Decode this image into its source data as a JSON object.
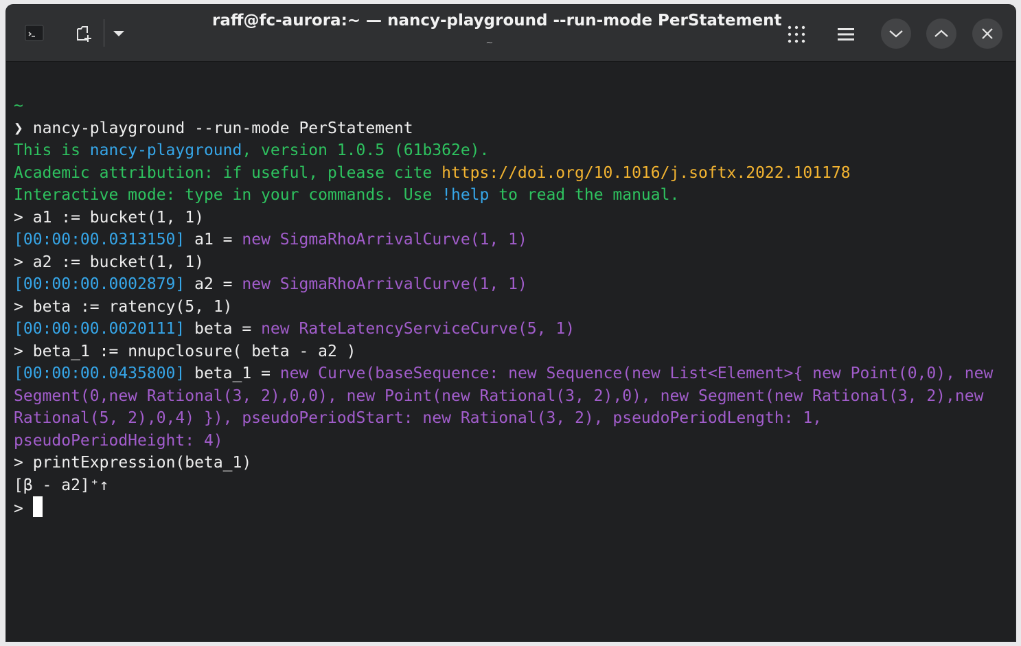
{
  "window": {
    "title": "raff@fc-aurora:~ — nancy-playground --run-mode PerStatement",
    "subtitle": "~"
  },
  "toolbar": {
    "terminal_icon": "terminal-icon",
    "new_tab_icon": "new-tab-icon",
    "dropdown_icon": "chevron-down-icon",
    "grid_icon": "grid-icon",
    "menu_icon": "hamburger-menu-icon",
    "minimize_icon": "chevron-down-icon",
    "maximize_icon": "chevron-up-icon",
    "close_icon": "close-icon"
  },
  "colors": {
    "green": "#2ec25f",
    "blue": "#36a6e8",
    "orange": "#f3b431",
    "purple": "#a25dcc",
    "text": "#eeeeee"
  },
  "terminal": {
    "cwd": "~",
    "prompt_symbol": "❯",
    "command": "nancy-playground --run-mode PerStatement",
    "banner": {
      "l1_a": "This is ",
      "l1_b": "nancy-playground",
      "l1_c": ", version 1.0.5 (61b362e).",
      "l2_a": "Academic attribution: if useful, please cite ",
      "l2_b": "https://doi.org/10.1016/j.softx.2022.101178",
      "l3_a": "Interactive mode: type in your commands. Use ",
      "l3_b": "!help",
      "l3_c": " to read the manual."
    },
    "input_prompt": ">",
    "entries": [
      {
        "input": "a1 := bucket(1, 1)",
        "time": "[00:00:00.0313150]",
        "name": "a1",
        "eq": "=",
        "value": "new SigmaRhoArrivalCurve(1, 1)"
      },
      {
        "input": "a2 := bucket(1, 1)",
        "time": "[00:00:00.0002879]",
        "name": "a2",
        "eq": "=",
        "value": "new SigmaRhoArrivalCurve(1, 1)"
      },
      {
        "input": "beta := ratency(5, 1)",
        "time": "[00:00:00.0020111]",
        "name": "beta",
        "eq": "=",
        "value": "new RateLatencyServiceCurve(5, 1)"
      },
      {
        "input": "beta_1 := nnupclosure( beta - a2 )",
        "time": "[00:00:00.0435800]",
        "name": "beta_1",
        "eq": "=",
        "value": "new Curve(baseSequence: new Sequence(new List<Element>{ new Point(0,0), new Segment(0,new Rational(3, 2),0,0), new Point(new Rational(3, 2),0), new Segment(new Rational(3, 2),new Rational(5, 2),0,4) }), pseudoPeriodStart: new Rational(3, 2), pseudoPeriodLength: 1, pseudoPeriodHeight: 4)"
      }
    ],
    "print_input": "printExpression(beta_1)",
    "print_output": "[β - a2]⁺↑"
  }
}
